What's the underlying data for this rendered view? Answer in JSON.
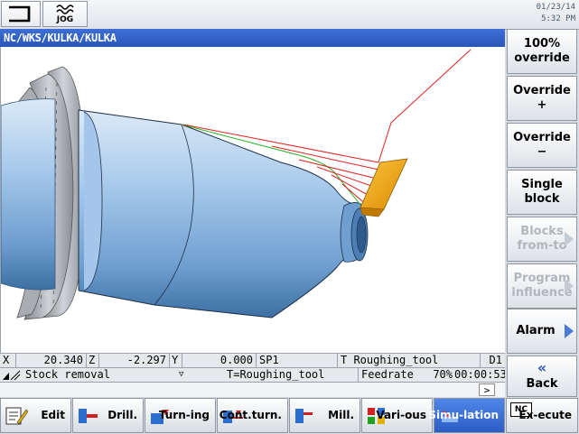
{
  "top": {
    "mode_label": "JOG",
    "date": "01/23/14",
    "time": "5:32 PM"
  },
  "title": "NC/WKS/KULKA/KULKA",
  "status": {
    "x_label": "X",
    "x_value": "20.340",
    "z_label": "Z",
    "z_value": "-2.297",
    "y_label": "Y",
    "y_value": "0.000",
    "spindle": "SP1",
    "tool": "T Roughing_tool",
    "d": "D1",
    "cycle": "Stock removal",
    "tool2": "T=Roughing_tool",
    "feedrate_label": "Feedrate",
    "feed_pct": "70%",
    "time": "00:00:53",
    "scroll_arrow": ">"
  },
  "right_softkeys": [
    {
      "label1": "100%",
      "label2": "override",
      "enabled": true
    },
    {
      "label1": "Override",
      "label2": "+",
      "enabled": true
    },
    {
      "label1": "Override",
      "label2": "−",
      "enabled": true
    },
    {
      "label1": "Single",
      "label2": "block",
      "enabled": true
    },
    {
      "label1": "Blocks",
      "label2": "from-to",
      "enabled": false
    },
    {
      "label1": "Program",
      "label2": "influence",
      "enabled": false
    },
    {
      "label1": "Alarm",
      "label2": "",
      "enabled": true
    },
    {
      "label1": "«",
      "label2": "Back",
      "enabled": true
    }
  ],
  "bottom_softkeys": [
    {
      "label1": "Edit",
      "label2": ""
    },
    {
      "label1": "Drill.",
      "label2": ""
    },
    {
      "label1": "Turn-",
      "label2": "ing"
    },
    {
      "label1": "Cont.",
      "label2": "turn."
    },
    {
      "label1": "Mill.",
      "label2": ""
    },
    {
      "label1": "Vari-",
      "label2": "ous"
    },
    {
      "label1": "Simu-",
      "label2": "lation"
    },
    {
      "label1": "Ex-",
      "label2": "ecute",
      "badge": "NC"
    }
  ],
  "colors": {
    "title_bg": "#2a56b8",
    "active_softkey": "#2c5cc4",
    "part": "#9cc3e6",
    "tool": "#f0a800",
    "toolpath": "#e02020",
    "stock_line": "#20b020"
  }
}
